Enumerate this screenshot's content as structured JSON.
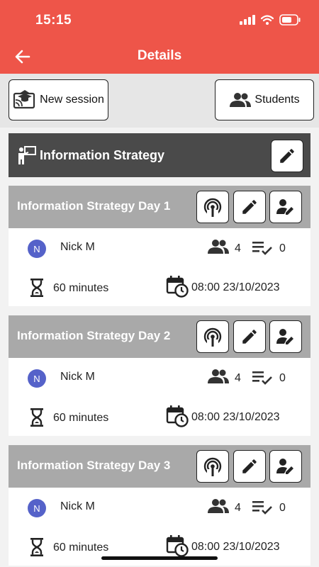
{
  "status_bar": {
    "time": "15:15"
  },
  "nav": {
    "title": "Details"
  },
  "toolbar": {
    "new_session_label": "New session",
    "students_label": "Students"
  },
  "course": {
    "title": "Information Strategy"
  },
  "sessions": [
    {
      "title": "Information Strategy Day 1",
      "avatar_initial": "N",
      "trainer": "Nick M",
      "participants": "4",
      "completed": "0",
      "duration": "60 minutes",
      "datetime": "08:00 23/10/2023"
    },
    {
      "title": "Information Strategy Day 2",
      "avatar_initial": "N",
      "trainer": "Nick M",
      "participants": "4",
      "completed": "0",
      "duration": "60 minutes",
      "datetime": "08:00 23/10/2023"
    },
    {
      "title": "Information Strategy Day 3",
      "avatar_initial": "N",
      "trainer": "Nick M",
      "participants": "4",
      "completed": "0",
      "duration": "60 minutes",
      "datetime": "08:00 23/10/2023"
    }
  ],
  "colors": {
    "header": "#ee5549",
    "avatar": "#5562c9",
    "card_header": "#a9a9a9",
    "course_bar": "#4a4a4a"
  },
  "icons": [
    "back-arrow-icon",
    "presentation-icon",
    "group-icon",
    "teacher-icon",
    "edit-pencil-icon",
    "broadcast-icon",
    "user-edit-icon",
    "people-icon",
    "checklist-icon",
    "hourglass-icon",
    "calendar-clock-icon"
  ]
}
